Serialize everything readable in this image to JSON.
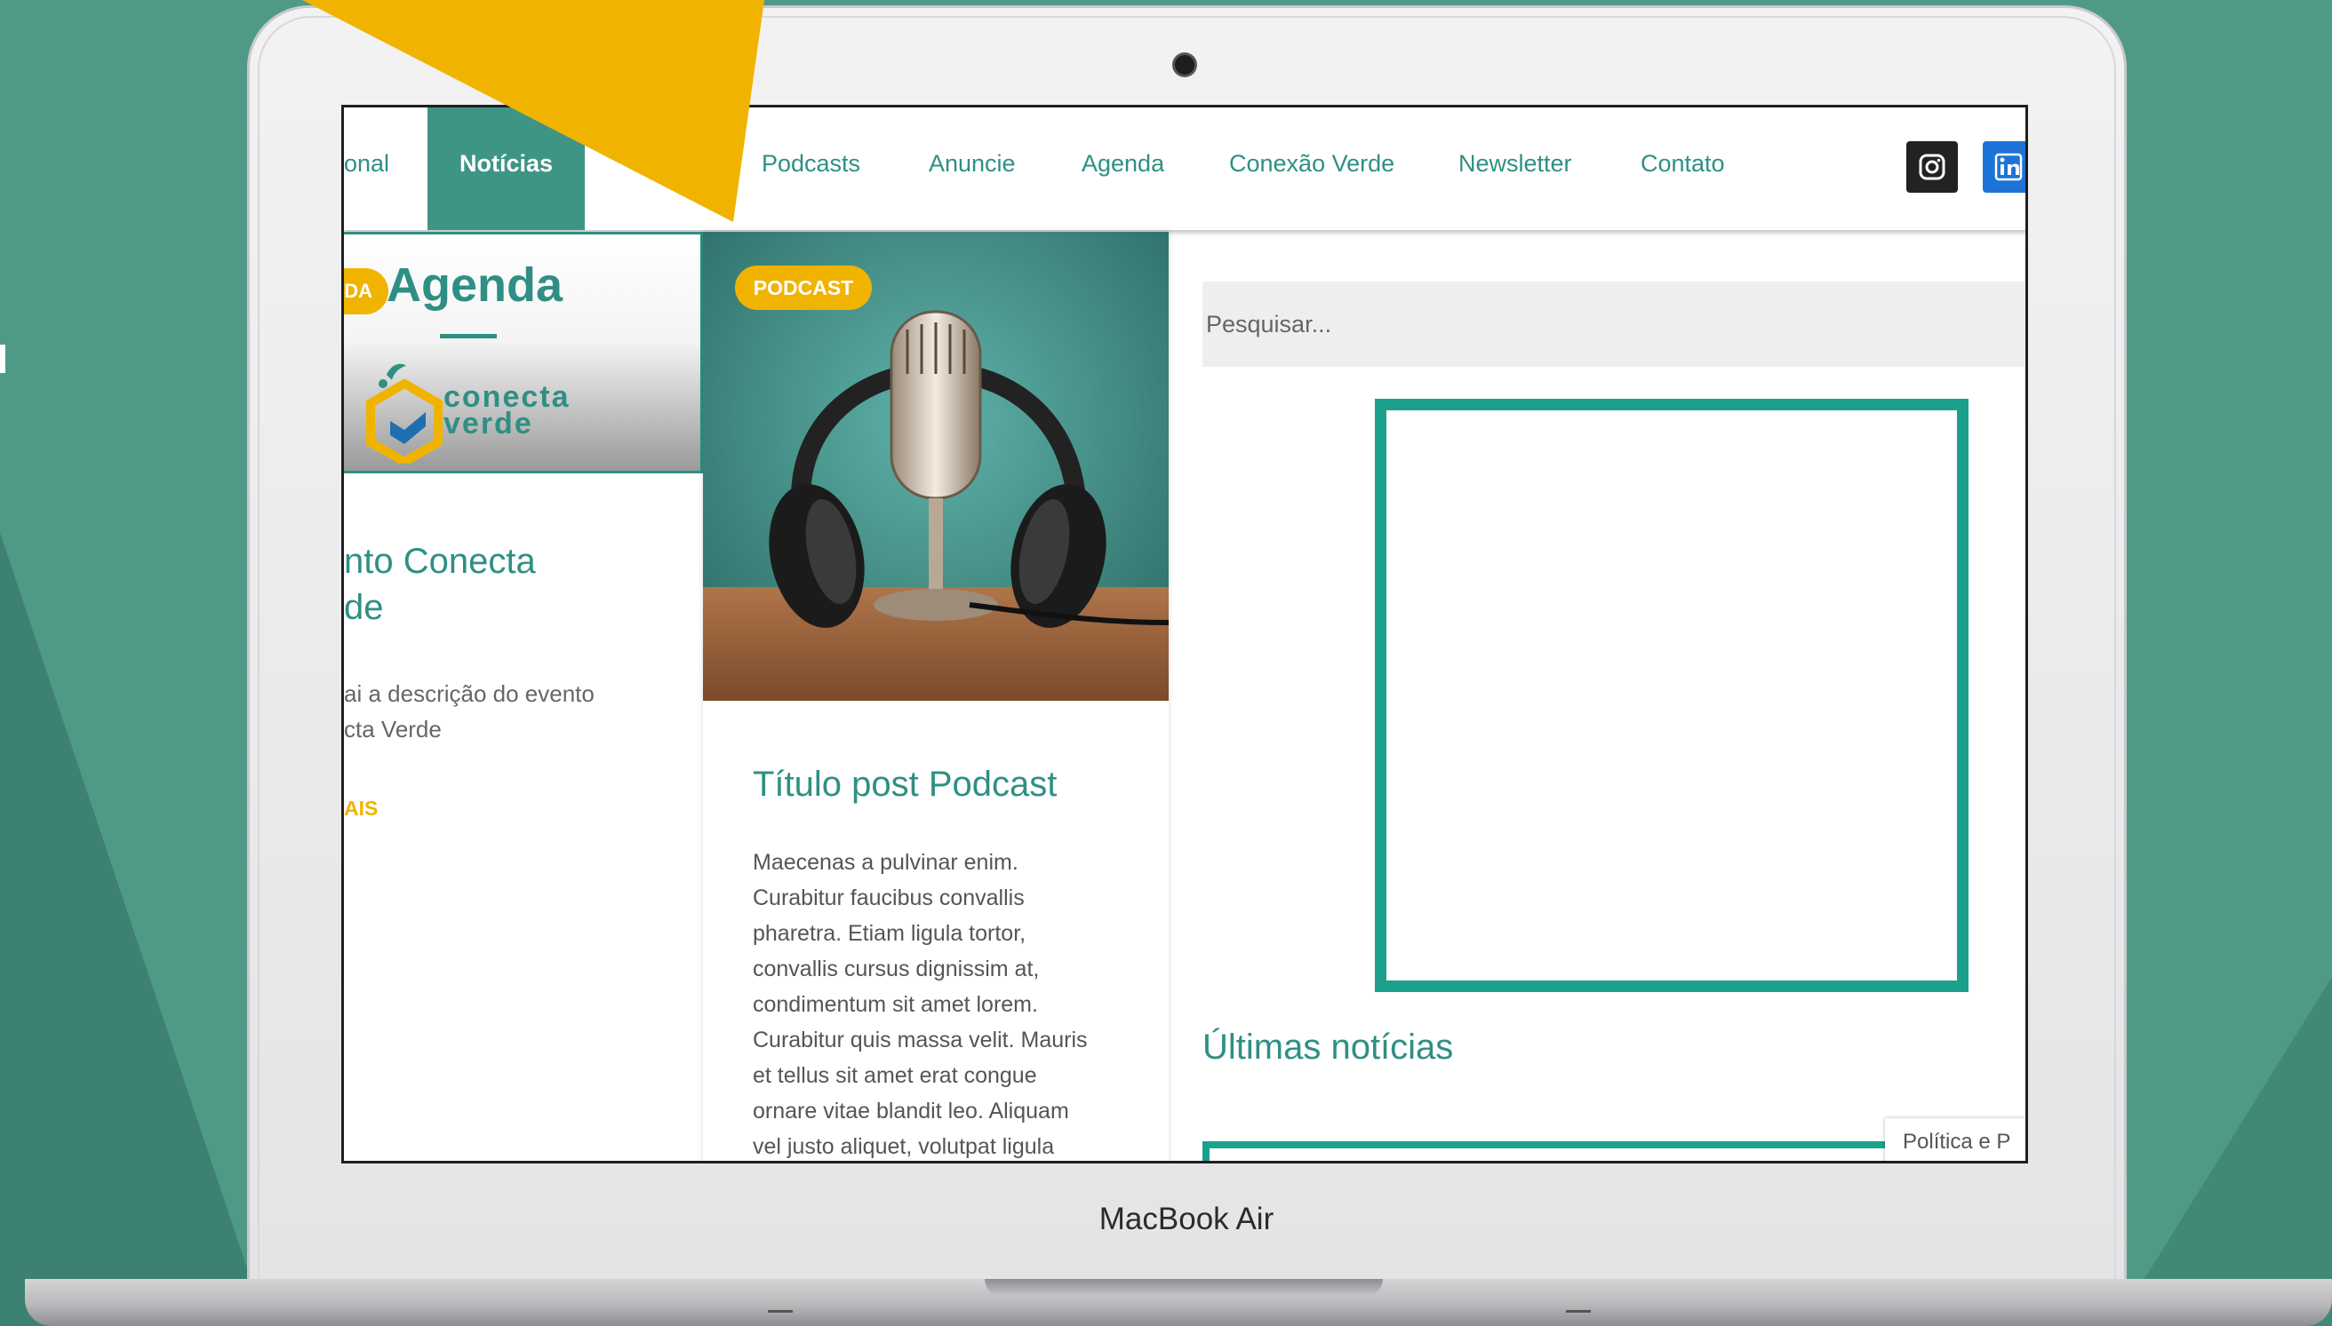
{
  "device": {
    "label": "MacBook Air"
  },
  "nav": {
    "partial_item": "onal",
    "active_item": "Notícias",
    "items": [
      "Podcasts",
      "Anuncie",
      "Agenda",
      "Conexão Verde",
      "Newsletter",
      "Contato"
    ],
    "social_icons": [
      "instagram-icon",
      "linkedin-icon"
    ]
  },
  "agenda_card": {
    "badge": "DA",
    "title": "Agenda",
    "logo_line1": "conecta",
    "logo_line2": "verde",
    "post_title_line1": "nto Conecta",
    "post_title_line2": "de",
    "description_line1": "ai a descrição do evento",
    "description_line2": "cta Verde",
    "read_more": "AIS"
  },
  "podcast_card": {
    "badge": "PODCAST",
    "title": "Título post Podcast",
    "excerpt_lines": [
      "Maecenas a pulvinar enim.",
      "Curabitur faucibus convallis",
      "pharetra. Etiam ligula tortor,",
      "convallis cursus dignissim at,",
      "condimentum sit amet lorem.",
      "Curabitur quis massa velit. Mauris",
      "et tellus sit amet erat congue",
      "ornare vitae blandit leo. Aliquam",
      "vel justo aliquet, volutpat ligula"
    ]
  },
  "sidebar": {
    "search_placeholder": "Pesquisar...",
    "latest_title": "Últimas notícias"
  },
  "cookie": {
    "label": "Política e P"
  },
  "colors": {
    "brand_green": "#2f8f84",
    "accent_yellow": "#f0b400",
    "frame_teal": "#1ba08c",
    "background": "#4f9a87"
  }
}
